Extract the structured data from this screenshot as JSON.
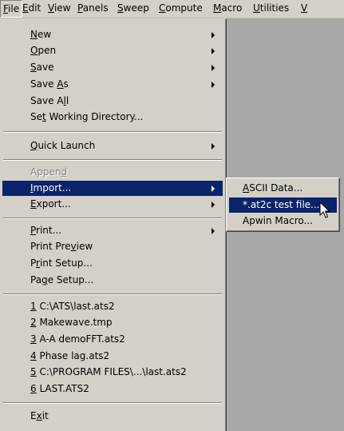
{
  "menubar": {
    "items": [
      {
        "pre": "",
        "mn": "F",
        "post": "ile"
      },
      {
        "pre": "",
        "mn": "E",
        "post": "dit"
      },
      {
        "pre": "",
        "mn": "V",
        "post": "iew"
      },
      {
        "pre": "",
        "mn": "P",
        "post": "anels"
      },
      {
        "pre": "",
        "mn": "S",
        "post": "weep"
      },
      {
        "pre": "",
        "mn": "C",
        "post": "ompute"
      },
      {
        "pre": "",
        "mn": "M",
        "post": "acro"
      },
      {
        "pre": "",
        "mn": "U",
        "post": "tilities"
      },
      {
        "pre": "",
        "mn": "V",
        "post": ""
      }
    ]
  },
  "file_menu": {
    "new": {
      "pre": "",
      "mn": "N",
      "post": "ew"
    },
    "open": {
      "pre": "",
      "mn": "O",
      "post": "pen"
    },
    "save": {
      "pre": "",
      "mn": "S",
      "post": "ave"
    },
    "save_as": {
      "pre": "Save ",
      "mn": "A",
      "post": "s"
    },
    "save_all": {
      "pre": "Save A",
      "mn": "l",
      "post": "l"
    },
    "set_wd": {
      "pre": "Se",
      "mn": "t",
      "post": " Working Directory..."
    },
    "quick_launch": {
      "pre": "",
      "mn": "Q",
      "post": "uick Launch"
    },
    "append": {
      "pre": "Appen",
      "mn": "d",
      "post": ""
    },
    "import": {
      "pre": "",
      "mn": "I",
      "post": "mport..."
    },
    "export": {
      "pre": "",
      "mn": "E",
      "post": "xport..."
    },
    "print": {
      "pre": "",
      "mn": "P",
      "post": "rint..."
    },
    "print_preview": {
      "pre": "Print Pre",
      "mn": "v",
      "post": "iew"
    },
    "print_setup": {
      "pre": "P",
      "mn": "r",
      "post": "int Setup..."
    },
    "page_setup": {
      "pre": "Pa",
      "mn": "g",
      "post": "e Setup..."
    },
    "recent": [
      {
        "pre": "",
        "mn": "1",
        "post": " C:\\ATS\\last.ats2"
      },
      {
        "pre": "",
        "mn": "2",
        "post": " Makewave.tmp"
      },
      {
        "pre": "",
        "mn": "3",
        "post": " A-A demoFFT.ats2"
      },
      {
        "pre": "",
        "mn": "4",
        "post": " Phase lag.ats2"
      },
      {
        "pre": "",
        "mn": "5",
        "post": " C:\\PROGRAM FILES\\...\\last.ats2"
      },
      {
        "pre": "",
        "mn": "6",
        "post": " LAST.ATS2"
      }
    ],
    "exit": {
      "pre": "E",
      "mn": "x",
      "post": "it"
    }
  },
  "import_submenu": {
    "ascii": {
      "pre": "",
      "mn": "A",
      "post": "SCII Data..."
    },
    "at2c": {
      "pre": "*.at2c test file...",
      "mn": "",
      "post": ""
    },
    "apwin": {
      "pre": "Apwin Macro...",
      "mn": "",
      "post": ""
    }
  },
  "colors": {
    "menu_bg": "#d4d0c8",
    "highlight": "#0a246a",
    "client_bg": "#a8a8a8"
  },
  "icons": {
    "submenu_arrow": "right-triangle",
    "cursor": "arrow-pointer"
  }
}
